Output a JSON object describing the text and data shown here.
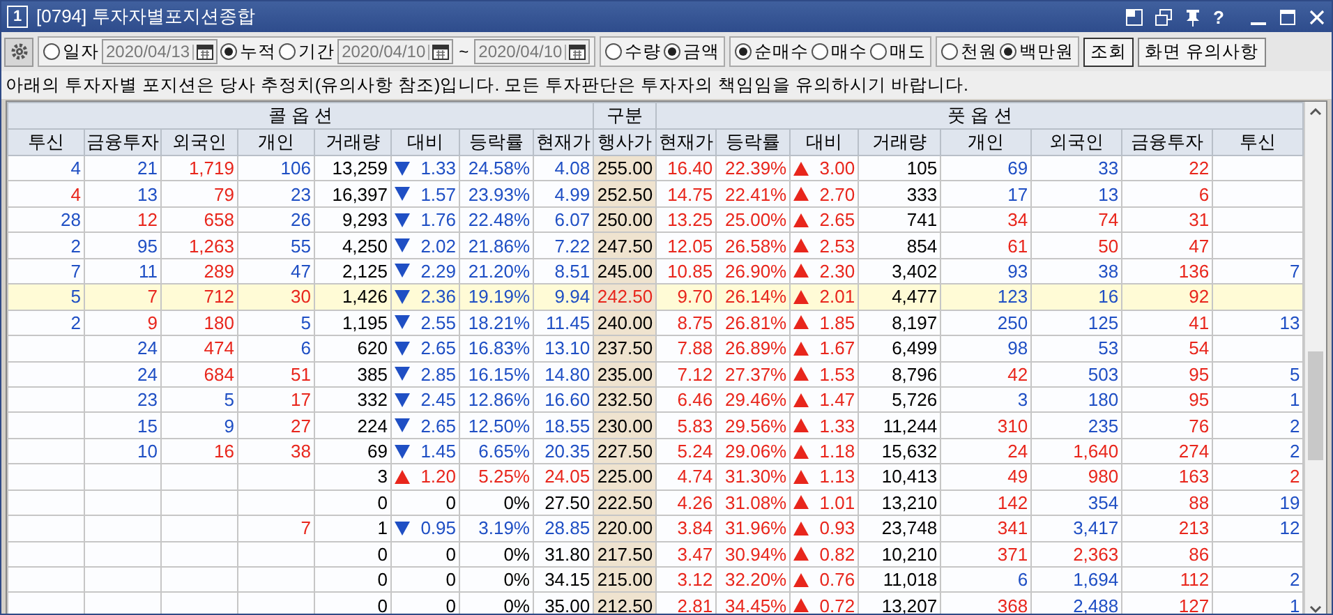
{
  "window": {
    "number": "1",
    "title": "[0794] 투자자별포지션종합",
    "help": "?"
  },
  "toolbar": {
    "groups": [
      [
        {
          "kind": "radio",
          "label": "일자",
          "checked": false
        },
        {
          "kind": "date",
          "value": "2020/04/13"
        },
        {
          "kind": "radio",
          "label": "누적",
          "checked": true
        },
        {
          "kind": "radio",
          "label": "기간",
          "checked": false
        },
        {
          "kind": "date",
          "value": "2020/04/10"
        },
        {
          "kind": "text",
          "label": "~"
        },
        {
          "kind": "date",
          "value": "2020/04/10"
        }
      ],
      [
        {
          "kind": "radio",
          "label": "수량",
          "checked": false
        },
        {
          "kind": "radio",
          "label": "금액",
          "checked": true
        }
      ],
      [
        {
          "kind": "radio",
          "label": "순매수",
          "checked": true
        },
        {
          "kind": "radio",
          "label": "매수",
          "checked": false
        },
        {
          "kind": "radio",
          "label": "매도",
          "checked": false
        }
      ],
      [
        {
          "kind": "radio",
          "label": "천원",
          "checked": false
        },
        {
          "kind": "radio",
          "label": "백만원",
          "checked": true
        }
      ]
    ],
    "buttons": [
      "조회",
      "화면 유의사항"
    ]
  },
  "notice": "아래의 투자자별 포지션은 당사 추정치(유의사항 참조)입니다. 모든 투자판단은 투자자의 책임임을 유의하시기 바랍니다.",
  "table": {
    "call_title": "콜 옵 션",
    "strike_title": "구분",
    "put_title": "풋 옵 션",
    "call_columns": [
      "투신",
      "금융투자",
      "외국인",
      "개인",
      "거래량",
      "대비",
      "등락률",
      "현재가"
    ],
    "strike_column": "행사가",
    "put_columns": [
      "현재가",
      "등락률",
      "대비",
      "거래량",
      "개인",
      "외국인",
      "금융투자",
      "투신"
    ],
    "rows": [
      {
        "selected": false,
        "strike": {
          "v": "255.00",
          "color": "#000000"
        },
        "call": {
          "inv_trust": {
            "v": "4",
            "color": "#1f4fc4"
          },
          "fin_invest": {
            "v": "21",
            "color": "#1f4fc4"
          },
          "foreign": {
            "v": "1,719",
            "color": "#e8261c"
          },
          "individual": {
            "v": "106",
            "color": "#1f4fc4"
          },
          "volume": {
            "v": "13,259",
            "color": "#000000"
          },
          "change": {
            "v": "1.33",
            "color": "#1f4fc4",
            "rising": false
          },
          "rate": {
            "v": "24.58%",
            "color": "#1f4fc4"
          },
          "price": {
            "v": "4.08",
            "color": "#1f4fc4"
          }
        },
        "put": {
          "price": {
            "v": "16.40",
            "color": "#e8261c"
          },
          "rate": {
            "v": "22.39%",
            "color": "#e8261c"
          },
          "change": {
            "v": "3.00",
            "color": "#e8261c",
            "rising": true
          },
          "volume": {
            "v": "105",
            "color": "#000000"
          },
          "individual": {
            "v": "69",
            "color": "#1f4fc4"
          },
          "foreign": {
            "v": "33",
            "color": "#1f4fc4"
          },
          "fin_invest": {
            "v": "22",
            "color": "#e8261c"
          }
        }
      },
      {
        "selected": false,
        "strike": {
          "v": "252.50",
          "color": "#000000"
        },
        "call": {
          "inv_trust": {
            "v": "4",
            "color": "#e8261c"
          },
          "fin_invest": {
            "v": "13",
            "color": "#1f4fc4"
          },
          "foreign": {
            "v": "79",
            "color": "#e8261c"
          },
          "individual": {
            "v": "23",
            "color": "#1f4fc4"
          },
          "volume": {
            "v": "16,397",
            "color": "#000000"
          },
          "change": {
            "v": "1.57",
            "color": "#1f4fc4",
            "rising": false
          },
          "rate": {
            "v": "23.93%",
            "color": "#1f4fc4"
          },
          "price": {
            "v": "4.99",
            "color": "#1f4fc4"
          }
        },
        "put": {
          "price": {
            "v": "14.75",
            "color": "#e8261c"
          },
          "rate": {
            "v": "22.41%",
            "color": "#e8261c"
          },
          "change": {
            "v": "2.70",
            "color": "#e8261c",
            "rising": true
          },
          "volume": {
            "v": "333",
            "color": "#000000"
          },
          "individual": {
            "v": "17",
            "color": "#1f4fc4"
          },
          "foreign": {
            "v": "13",
            "color": "#1f4fc4"
          },
          "fin_invest": {
            "v": "6",
            "color": "#e8261c"
          }
        }
      },
      {
        "selected": false,
        "strike": {
          "v": "250.00",
          "color": "#000000"
        },
        "call": {
          "inv_trust": {
            "v": "28",
            "color": "#1f4fc4"
          },
          "fin_invest": {
            "v": "12",
            "color": "#e8261c"
          },
          "foreign": {
            "v": "658",
            "color": "#e8261c"
          },
          "individual": {
            "v": "26",
            "color": "#1f4fc4"
          },
          "volume": {
            "v": "9,293",
            "color": "#000000"
          },
          "change": {
            "v": "1.76",
            "color": "#1f4fc4",
            "rising": false
          },
          "rate": {
            "v": "22.48%",
            "color": "#1f4fc4"
          },
          "price": {
            "v": "6.07",
            "color": "#1f4fc4"
          }
        },
        "put": {
          "price": {
            "v": "13.25",
            "color": "#e8261c"
          },
          "rate": {
            "v": "25.00%",
            "color": "#e8261c"
          },
          "change": {
            "v": "2.65",
            "color": "#e8261c",
            "rising": true
          },
          "volume": {
            "v": "741",
            "color": "#000000"
          },
          "individual": {
            "v": "34",
            "color": "#e8261c"
          },
          "foreign": {
            "v": "74",
            "color": "#e8261c"
          },
          "fin_invest": {
            "v": "31",
            "color": "#e8261c"
          }
        }
      },
      {
        "selected": false,
        "strike": {
          "v": "247.50",
          "color": "#000000"
        },
        "call": {
          "inv_trust": {
            "v": "2",
            "color": "#1f4fc4"
          },
          "fin_invest": {
            "v": "95",
            "color": "#1f4fc4"
          },
          "foreign": {
            "v": "1,263",
            "color": "#e8261c"
          },
          "individual": {
            "v": "55",
            "color": "#1f4fc4"
          },
          "volume": {
            "v": "4,250",
            "color": "#000000"
          },
          "change": {
            "v": "2.02",
            "color": "#1f4fc4",
            "rising": false
          },
          "rate": {
            "v": "21.86%",
            "color": "#1f4fc4"
          },
          "price": {
            "v": "7.22",
            "color": "#1f4fc4"
          }
        },
        "put": {
          "price": {
            "v": "12.05",
            "color": "#e8261c"
          },
          "rate": {
            "v": "26.58%",
            "color": "#e8261c"
          },
          "change": {
            "v": "2.53",
            "color": "#e8261c",
            "rising": true
          },
          "volume": {
            "v": "854",
            "color": "#000000"
          },
          "individual": {
            "v": "61",
            "color": "#e8261c"
          },
          "foreign": {
            "v": "50",
            "color": "#e8261c"
          },
          "fin_invest": {
            "v": "47",
            "color": "#e8261c"
          }
        }
      },
      {
        "selected": false,
        "strike": {
          "v": "245.00",
          "color": "#000000"
        },
        "call": {
          "inv_trust": {
            "v": "7",
            "color": "#1f4fc4"
          },
          "fin_invest": {
            "v": "11",
            "color": "#1f4fc4"
          },
          "foreign": {
            "v": "289",
            "color": "#e8261c"
          },
          "individual": {
            "v": "47",
            "color": "#1f4fc4"
          },
          "volume": {
            "v": "2,125",
            "color": "#000000"
          },
          "change": {
            "v": "2.29",
            "color": "#1f4fc4",
            "rising": false
          },
          "rate": {
            "v": "21.20%",
            "color": "#1f4fc4"
          },
          "price": {
            "v": "8.51",
            "color": "#1f4fc4"
          }
        },
        "put": {
          "price": {
            "v": "10.85",
            "color": "#e8261c"
          },
          "rate": {
            "v": "26.90%",
            "color": "#e8261c"
          },
          "change": {
            "v": "2.30",
            "color": "#e8261c",
            "rising": true
          },
          "volume": {
            "v": "3,402",
            "color": "#000000"
          },
          "individual": {
            "v": "93",
            "color": "#1f4fc4"
          },
          "foreign": {
            "v": "38",
            "color": "#1f4fc4"
          },
          "fin_invest": {
            "v": "136",
            "color": "#e8261c"
          },
          "inv_trust": {
            "v": "7",
            "color": "#1f4fc4"
          }
        }
      },
      {
        "selected": true,
        "strike": {
          "v": "242.50",
          "color": "#e8261c"
        },
        "call": {
          "inv_trust": {
            "v": "5",
            "color": "#1f4fc4"
          },
          "fin_invest": {
            "v": "7",
            "color": "#e8261c"
          },
          "foreign": {
            "v": "712",
            "color": "#e8261c"
          },
          "individual": {
            "v": "30",
            "color": "#e8261c"
          },
          "volume": {
            "v": "1,426",
            "color": "#000000"
          },
          "change": {
            "v": "2.36",
            "color": "#1f4fc4",
            "rising": false
          },
          "rate": {
            "v": "19.19%",
            "color": "#1f4fc4"
          },
          "price": {
            "v": "9.94",
            "color": "#1f4fc4"
          }
        },
        "put": {
          "price": {
            "v": "9.70",
            "color": "#e8261c"
          },
          "rate": {
            "v": "26.14%",
            "color": "#e8261c"
          },
          "change": {
            "v": "2.01",
            "color": "#e8261c",
            "rising": true
          },
          "volume": {
            "v": "4,477",
            "color": "#000000"
          },
          "individual": {
            "v": "123",
            "color": "#1f4fc4"
          },
          "foreign": {
            "v": "16",
            "color": "#1f4fc4"
          },
          "fin_invest": {
            "v": "92",
            "color": "#e8261c"
          }
        }
      },
      {
        "selected": false,
        "strike": {
          "v": "240.00",
          "color": "#000000"
        },
        "call": {
          "inv_trust": {
            "v": "2",
            "color": "#1f4fc4"
          },
          "fin_invest": {
            "v": "9",
            "color": "#e8261c"
          },
          "foreign": {
            "v": "180",
            "color": "#e8261c"
          },
          "individual": {
            "v": "5",
            "color": "#1f4fc4"
          },
          "volume": {
            "v": "1,195",
            "color": "#000000"
          },
          "change": {
            "v": "2.55",
            "color": "#1f4fc4",
            "rising": false
          },
          "rate": {
            "v": "18.21%",
            "color": "#1f4fc4"
          },
          "price": {
            "v": "11.45",
            "color": "#1f4fc4"
          }
        },
        "put": {
          "price": {
            "v": "8.75",
            "color": "#e8261c"
          },
          "rate": {
            "v": "26.81%",
            "color": "#e8261c"
          },
          "change": {
            "v": "1.85",
            "color": "#e8261c",
            "rising": true
          },
          "volume": {
            "v": "8,197",
            "color": "#000000"
          },
          "individual": {
            "v": "250",
            "color": "#1f4fc4"
          },
          "foreign": {
            "v": "125",
            "color": "#1f4fc4"
          },
          "fin_invest": {
            "v": "41",
            "color": "#e8261c"
          },
          "inv_trust": {
            "v": "13",
            "color": "#1f4fc4"
          }
        }
      },
      {
        "selected": false,
        "strike": {
          "v": "237.50",
          "color": "#000000"
        },
        "call": {
          "fin_invest": {
            "v": "24",
            "color": "#1f4fc4"
          },
          "foreign": {
            "v": "474",
            "color": "#e8261c"
          },
          "individual": {
            "v": "6",
            "color": "#1f4fc4"
          },
          "volume": {
            "v": "620",
            "color": "#000000"
          },
          "change": {
            "v": "2.65",
            "color": "#1f4fc4",
            "rising": false
          },
          "rate": {
            "v": "16.83%",
            "color": "#1f4fc4"
          },
          "price": {
            "v": "13.10",
            "color": "#1f4fc4"
          }
        },
        "put": {
          "price": {
            "v": "7.88",
            "color": "#e8261c"
          },
          "rate": {
            "v": "26.89%",
            "color": "#e8261c"
          },
          "change": {
            "v": "1.67",
            "color": "#e8261c",
            "rising": true
          },
          "volume": {
            "v": "6,499",
            "color": "#000000"
          },
          "individual": {
            "v": "98",
            "color": "#1f4fc4"
          },
          "foreign": {
            "v": "53",
            "color": "#1f4fc4"
          },
          "fin_invest": {
            "v": "54",
            "color": "#e8261c"
          }
        }
      },
      {
        "selected": false,
        "strike": {
          "v": "235.00",
          "color": "#000000"
        },
        "call": {
          "fin_invest": {
            "v": "24",
            "color": "#1f4fc4"
          },
          "foreign": {
            "v": "684",
            "color": "#e8261c"
          },
          "individual": {
            "v": "51",
            "color": "#e8261c"
          },
          "volume": {
            "v": "385",
            "color": "#000000"
          },
          "change": {
            "v": "2.85",
            "color": "#1f4fc4",
            "rising": false
          },
          "rate": {
            "v": "16.15%",
            "color": "#1f4fc4"
          },
          "price": {
            "v": "14.80",
            "color": "#1f4fc4"
          }
        },
        "put": {
          "price": {
            "v": "7.12",
            "color": "#e8261c"
          },
          "rate": {
            "v": "27.37%",
            "color": "#e8261c"
          },
          "change": {
            "v": "1.53",
            "color": "#e8261c",
            "rising": true
          },
          "volume": {
            "v": "8,796",
            "color": "#000000"
          },
          "individual": {
            "v": "42",
            "color": "#e8261c"
          },
          "foreign": {
            "v": "503",
            "color": "#1f4fc4"
          },
          "fin_invest": {
            "v": "95",
            "color": "#e8261c"
          },
          "inv_trust": {
            "v": "5",
            "color": "#1f4fc4"
          }
        }
      },
      {
        "selected": false,
        "strike": {
          "v": "232.50",
          "color": "#000000"
        },
        "call": {
          "fin_invest": {
            "v": "23",
            "color": "#1f4fc4"
          },
          "foreign": {
            "v": "5",
            "color": "#1f4fc4"
          },
          "individual": {
            "v": "17",
            "color": "#e8261c"
          },
          "volume": {
            "v": "332",
            "color": "#000000"
          },
          "change": {
            "v": "2.45",
            "color": "#1f4fc4",
            "rising": false
          },
          "rate": {
            "v": "12.86%",
            "color": "#1f4fc4"
          },
          "price": {
            "v": "16.60",
            "color": "#1f4fc4"
          }
        },
        "put": {
          "price": {
            "v": "6.46",
            "color": "#e8261c"
          },
          "rate": {
            "v": "29.46%",
            "color": "#e8261c"
          },
          "change": {
            "v": "1.47",
            "color": "#e8261c",
            "rising": true
          },
          "volume": {
            "v": "5,726",
            "color": "#000000"
          },
          "individual": {
            "v": "3",
            "color": "#1f4fc4"
          },
          "foreign": {
            "v": "180",
            "color": "#1f4fc4"
          },
          "fin_invest": {
            "v": "95",
            "color": "#e8261c"
          },
          "inv_trust": {
            "v": "1",
            "color": "#1f4fc4"
          }
        }
      },
      {
        "selected": false,
        "strike": {
          "v": "230.00",
          "color": "#000000"
        },
        "call": {
          "fin_invest": {
            "v": "15",
            "color": "#1f4fc4"
          },
          "foreign": {
            "v": "9",
            "color": "#1f4fc4"
          },
          "individual": {
            "v": "27",
            "color": "#e8261c"
          },
          "volume": {
            "v": "224",
            "color": "#000000"
          },
          "change": {
            "v": "2.65",
            "color": "#1f4fc4",
            "rising": false
          },
          "rate": {
            "v": "12.50%",
            "color": "#1f4fc4"
          },
          "price": {
            "v": "18.55",
            "color": "#1f4fc4"
          }
        },
        "put": {
          "price": {
            "v": "5.83",
            "color": "#e8261c"
          },
          "rate": {
            "v": "29.56%",
            "color": "#e8261c"
          },
          "change": {
            "v": "1.33",
            "color": "#e8261c",
            "rising": true
          },
          "volume": {
            "v": "11,244",
            "color": "#000000"
          },
          "individual": {
            "v": "310",
            "color": "#e8261c"
          },
          "foreign": {
            "v": "235",
            "color": "#1f4fc4"
          },
          "fin_invest": {
            "v": "76",
            "color": "#e8261c"
          },
          "inv_trust": {
            "v": "2",
            "color": "#1f4fc4"
          }
        }
      },
      {
        "selected": false,
        "strike": {
          "v": "227.50",
          "color": "#000000"
        },
        "call": {
          "fin_invest": {
            "v": "10",
            "color": "#1f4fc4"
          },
          "foreign": {
            "v": "16",
            "color": "#e8261c"
          },
          "individual": {
            "v": "38",
            "color": "#e8261c"
          },
          "volume": {
            "v": "69",
            "color": "#000000"
          },
          "change": {
            "v": "1.45",
            "color": "#1f4fc4",
            "rising": false
          },
          "rate": {
            "v": "6.65%",
            "color": "#1f4fc4"
          },
          "price": {
            "v": "20.35",
            "color": "#1f4fc4"
          }
        },
        "put": {
          "price": {
            "v": "5.24",
            "color": "#e8261c"
          },
          "rate": {
            "v": "29.06%",
            "color": "#e8261c"
          },
          "change": {
            "v": "1.18",
            "color": "#e8261c",
            "rising": true
          },
          "volume": {
            "v": "15,632",
            "color": "#000000"
          },
          "individual": {
            "v": "24",
            "color": "#e8261c"
          },
          "foreign": {
            "v": "1,640",
            "color": "#e8261c"
          },
          "fin_invest": {
            "v": "274",
            "color": "#e8261c"
          },
          "inv_trust": {
            "v": "2",
            "color": "#1f4fc4"
          }
        }
      },
      {
        "selected": false,
        "strike": {
          "v": "225.00",
          "color": "#000000"
        },
        "call": {
          "volume": {
            "v": "3",
            "color": "#000000"
          },
          "change": {
            "v": "1.20",
            "color": "#e8261c",
            "rising": true
          },
          "rate": {
            "v": "5.25%",
            "color": "#e8261c"
          },
          "price": {
            "v": "24.05",
            "color": "#e8261c"
          }
        },
        "put": {
          "price": {
            "v": "4.74",
            "color": "#e8261c"
          },
          "rate": {
            "v": "31.30%",
            "color": "#e8261c"
          },
          "change": {
            "v": "1.13",
            "color": "#e8261c",
            "rising": true
          },
          "volume": {
            "v": "10,413",
            "color": "#000000"
          },
          "individual": {
            "v": "49",
            "color": "#e8261c"
          },
          "foreign": {
            "v": "980",
            "color": "#e8261c"
          },
          "fin_invest": {
            "v": "163",
            "color": "#e8261c"
          },
          "inv_trust": {
            "v": "2",
            "color": "#e8261c"
          }
        }
      },
      {
        "selected": false,
        "strike": {
          "v": "222.50",
          "color": "#000000"
        },
        "call": {
          "volume": {
            "v": "0",
            "color": "#000000"
          },
          "change": {
            "v": "0",
            "color": "#000000"
          },
          "rate": {
            "v": "0%",
            "color": "#000000"
          },
          "price": {
            "v": "27.50",
            "color": "#000000"
          }
        },
        "put": {
          "price": {
            "v": "4.26",
            "color": "#e8261c"
          },
          "rate": {
            "v": "31.08%",
            "color": "#e8261c"
          },
          "change": {
            "v": "1.01",
            "color": "#e8261c",
            "rising": true
          },
          "volume": {
            "v": "13,210",
            "color": "#000000"
          },
          "individual": {
            "v": "142",
            "color": "#e8261c"
          },
          "foreign": {
            "v": "354",
            "color": "#1f4fc4"
          },
          "fin_invest": {
            "v": "88",
            "color": "#e8261c"
          },
          "inv_trust": {
            "v": "19",
            "color": "#1f4fc4"
          }
        }
      },
      {
        "selected": false,
        "strike": {
          "v": "220.00",
          "color": "#000000"
        },
        "call": {
          "individual": {
            "v": "7",
            "color": "#e8261c"
          },
          "volume": {
            "v": "1",
            "color": "#000000"
          },
          "change": {
            "v": "0.95",
            "color": "#1f4fc4",
            "rising": false
          },
          "rate": {
            "v": "3.19%",
            "color": "#1f4fc4"
          },
          "price": {
            "v": "28.85",
            "color": "#1f4fc4"
          }
        },
        "put": {
          "price": {
            "v": "3.84",
            "color": "#e8261c"
          },
          "rate": {
            "v": "31.96%",
            "color": "#e8261c"
          },
          "change": {
            "v": "0.93",
            "color": "#e8261c",
            "rising": true
          },
          "volume": {
            "v": "23,748",
            "color": "#000000"
          },
          "individual": {
            "v": "341",
            "color": "#e8261c"
          },
          "foreign": {
            "v": "3,417",
            "color": "#1f4fc4"
          },
          "fin_invest": {
            "v": "213",
            "color": "#e8261c"
          },
          "inv_trust": {
            "v": "12",
            "color": "#1f4fc4"
          }
        }
      },
      {
        "selected": false,
        "strike": {
          "v": "217.50",
          "color": "#000000"
        },
        "call": {
          "volume": {
            "v": "0",
            "color": "#000000"
          },
          "change": {
            "v": "0",
            "color": "#000000"
          },
          "rate": {
            "v": "0%",
            "color": "#000000"
          },
          "price": {
            "v": "31.80",
            "color": "#000000"
          }
        },
        "put": {
          "price": {
            "v": "3.47",
            "color": "#e8261c"
          },
          "rate": {
            "v": "30.94%",
            "color": "#e8261c"
          },
          "change": {
            "v": "0.82",
            "color": "#e8261c",
            "rising": true
          },
          "volume": {
            "v": "10,210",
            "color": "#000000"
          },
          "individual": {
            "v": "371",
            "color": "#e8261c"
          },
          "foreign": {
            "v": "2,363",
            "color": "#e8261c"
          },
          "fin_invest": {
            "v": "86",
            "color": "#e8261c"
          }
        }
      },
      {
        "selected": false,
        "strike": {
          "v": "215.00",
          "color": "#000000"
        },
        "call": {
          "volume": {
            "v": "0",
            "color": "#000000"
          },
          "change": {
            "v": "0",
            "color": "#000000"
          },
          "rate": {
            "v": "0%",
            "color": "#000000"
          },
          "price": {
            "v": "34.15",
            "color": "#000000"
          }
        },
        "put": {
          "price": {
            "v": "3.12",
            "color": "#e8261c"
          },
          "rate": {
            "v": "32.20%",
            "color": "#e8261c"
          },
          "change": {
            "v": "0.76",
            "color": "#e8261c",
            "rising": true
          },
          "volume": {
            "v": "11,018",
            "color": "#000000"
          },
          "individual": {
            "v": "6",
            "color": "#1f4fc4"
          },
          "foreign": {
            "v": "1,694",
            "color": "#1f4fc4"
          },
          "fin_invest": {
            "v": "112",
            "color": "#e8261c"
          },
          "inv_trust": {
            "v": "2",
            "color": "#1f4fc4"
          }
        }
      },
      {
        "selected": false,
        "strike": {
          "v": "212.50",
          "color": "#000000"
        },
        "call": {
          "volume": {
            "v": "0",
            "color": "#000000"
          },
          "change": {
            "v": "0",
            "color": "#000000"
          },
          "rate": {
            "v": "0%",
            "color": "#000000"
          },
          "price": {
            "v": "35.00",
            "color": "#000000"
          }
        },
        "put": {
          "price": {
            "v": "2.81",
            "color": "#e8261c"
          },
          "rate": {
            "v": "34.45%",
            "color": "#e8261c"
          },
          "change": {
            "v": "0.72",
            "color": "#e8261c",
            "rising": true
          },
          "volume": {
            "v": "13,207",
            "color": "#000000"
          },
          "individual": {
            "v": "368",
            "color": "#e8261c"
          },
          "foreign": {
            "v": "2,488",
            "color": "#1f4fc4"
          },
          "fin_invest": {
            "v": "127",
            "color": "#e8261c"
          },
          "inv_trust": {
            "v": "1",
            "color": "#1f4fc4"
          }
        }
      }
    ]
  }
}
